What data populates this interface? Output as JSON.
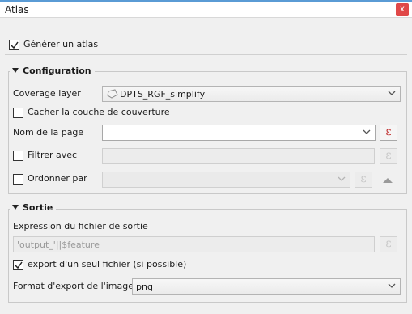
{
  "window": {
    "title": "Atlas",
    "close_glyph": "x"
  },
  "generate_atlas": {
    "label": "Générer un atlas",
    "checked": true
  },
  "configuration": {
    "title": "Configuration",
    "coverage_layer": {
      "label": "Coverage layer",
      "value": "DPTS_RGF_simplify",
      "icon": "polygon-layer-icon"
    },
    "hide_coverage": {
      "label": "Cacher la couche de couverture",
      "checked": false
    },
    "page_name": {
      "label": "Nom de la page",
      "value": ""
    },
    "filter_with": {
      "label": "Filtrer avec",
      "checked": false,
      "value": ""
    },
    "sort_by": {
      "label": "Ordonner par",
      "checked": false,
      "value": ""
    }
  },
  "output": {
    "title": "Sortie",
    "filename_expression": {
      "label": "Expression du fichier de sortie",
      "value": "'output_'||$feature"
    },
    "single_file": {
      "label": "export d'un seul fichier (si possible)",
      "checked": true
    },
    "image_format": {
      "label": "Format d'export de l'image",
      "value": "png"
    }
  },
  "icons": {
    "expression": "ε"
  },
  "colors": {
    "accent": "#5a9bd5",
    "close": "#e04848",
    "expression_icon": "#c03030"
  }
}
